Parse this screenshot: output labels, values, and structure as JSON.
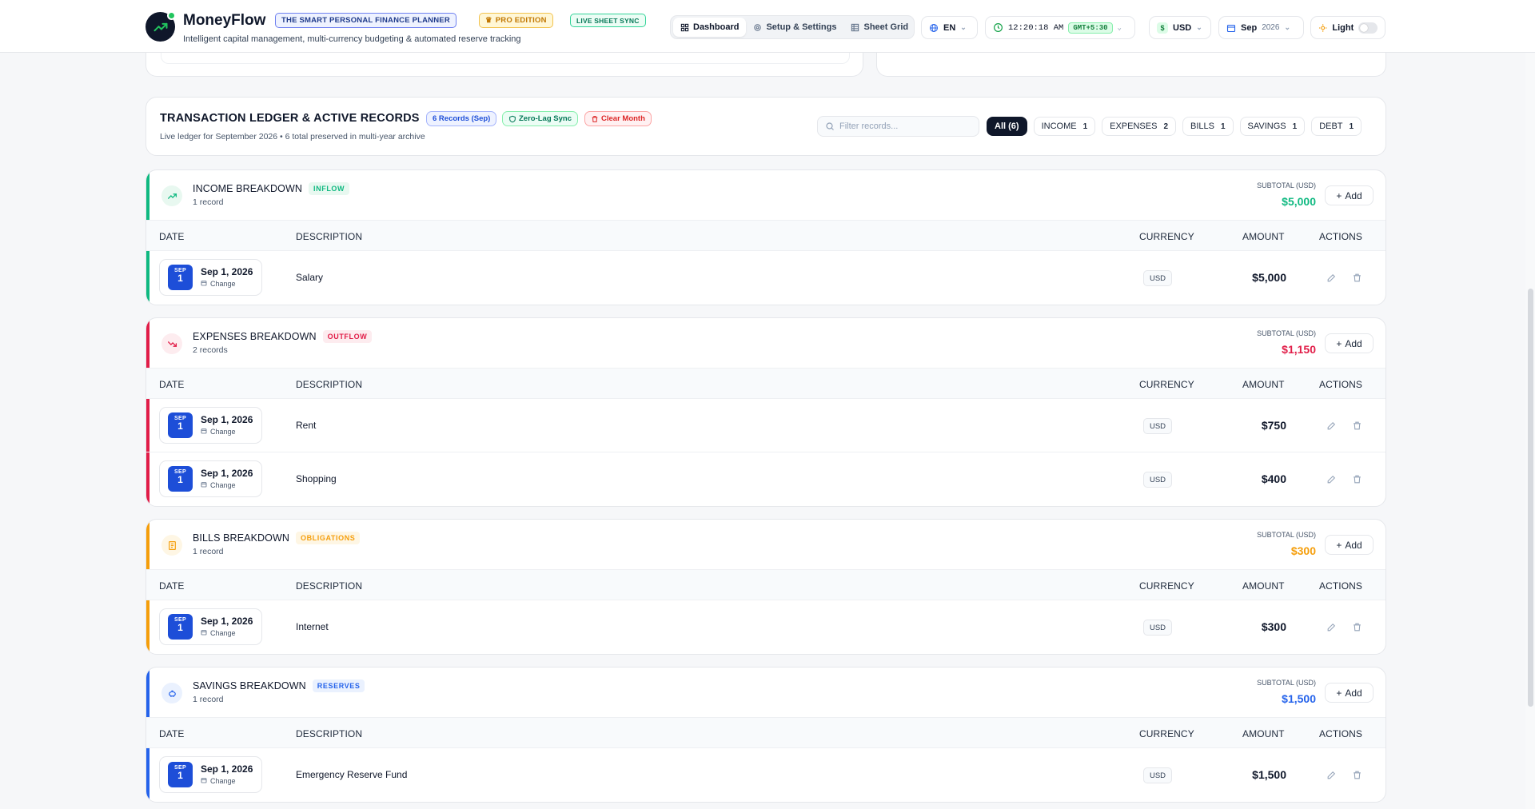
{
  "app": {
    "name": "MoneyFlow",
    "tagline": "THE SMART PERSONAL FINANCE PLANNER",
    "edition": "PRO EDITION",
    "sync": "LIVE SHEET SYNC",
    "subtitle": "Intelligent capital management, multi-currency budgeting & automated reserve tracking"
  },
  "nav": {
    "tabs": [
      {
        "label": "Dashboard",
        "icon": "grid-icon"
      },
      {
        "label": "Setup & Settings",
        "icon": "gear-icon"
      },
      {
        "label": "Sheet Grid",
        "icon": "table-icon"
      }
    ]
  },
  "controls": {
    "language": "EN",
    "time": "12:20:18 AM",
    "timezone": "GMT+5:30",
    "currency": "USD",
    "currency_symbol": "$",
    "month": "Sep",
    "year": "2026",
    "theme": "Light"
  },
  "ledger": {
    "title": "TRANSACTION LEDGER & ACTIVE RECORDS",
    "records_badge": "6 Records (Sep)",
    "sync_badge": "Zero-Lag Sync",
    "clear_label": "Clear Month",
    "subtitle": "Live ledger for September 2026 • 6 total preserved in multi-year archive",
    "search_placeholder": "Filter records...",
    "filters": [
      {
        "label": "All (6)",
        "count": ""
      },
      {
        "label": "INCOME",
        "count": "1"
      },
      {
        "label": "EXPENSES",
        "count": "2"
      },
      {
        "label": "BILLS",
        "count": "1"
      },
      {
        "label": "SAVINGS",
        "count": "1"
      },
      {
        "label": "DEBT",
        "count": "1"
      }
    ]
  },
  "table_headers": {
    "date": "DATE",
    "description": "DESCRIPTION",
    "currency": "CURRENCY",
    "amount": "AMOUNT",
    "actions": "ACTIONS"
  },
  "common": {
    "subtotal_label": "SUBTOTAL (USD)",
    "add_label": "Add",
    "change_label": "Change"
  },
  "sections": {
    "income": {
      "title": "INCOME BREAKDOWN",
      "tag": "INFLOW",
      "count": "1 record",
      "subtotal": "$5,000",
      "accent": "#10b981",
      "soft": "#e8f8f0",
      "rows": [
        {
          "month": "SEP",
          "day": "1",
          "date": "Sep 1, 2026",
          "description": "Salary",
          "currency": "USD",
          "amount": "$5,000"
        }
      ]
    },
    "expenses": {
      "title": "EXPENSES BREAKDOWN",
      "tag": "OUTFLOW",
      "count": "2 records",
      "subtotal": "$1,150",
      "accent": "#e11d48",
      "soft": "#fdecef",
      "rows": [
        {
          "month": "SEP",
          "day": "1",
          "date": "Sep 1, 2026",
          "description": "Rent",
          "currency": "USD",
          "amount": "$750"
        },
        {
          "month": "SEP",
          "day": "1",
          "date": "Sep 1, 2026",
          "description": "Shopping",
          "currency": "USD",
          "amount": "$400"
        }
      ]
    },
    "bills": {
      "title": "BILLS BREAKDOWN",
      "tag": "OBLIGATIONS",
      "count": "1 record",
      "subtotal": "$300",
      "accent": "#f59e0b",
      "soft": "#fef6e4",
      "rows": [
        {
          "month": "SEP",
          "day": "1",
          "date": "Sep 1, 2026",
          "description": "Internet",
          "currency": "USD",
          "amount": "$300"
        }
      ]
    },
    "savings": {
      "title": "SAVINGS BREAKDOWN",
      "tag": "RESERVES",
      "count": "1 record",
      "subtotal": "$1,500",
      "accent": "#2563eb",
      "soft": "#eaf1fe",
      "rows": [
        {
          "month": "SEP",
          "day": "1",
          "date": "Sep 1, 2026",
          "description": "Emergency Reserve Fund",
          "currency": "USD",
          "amount": "$1,500"
        }
      ]
    }
  }
}
